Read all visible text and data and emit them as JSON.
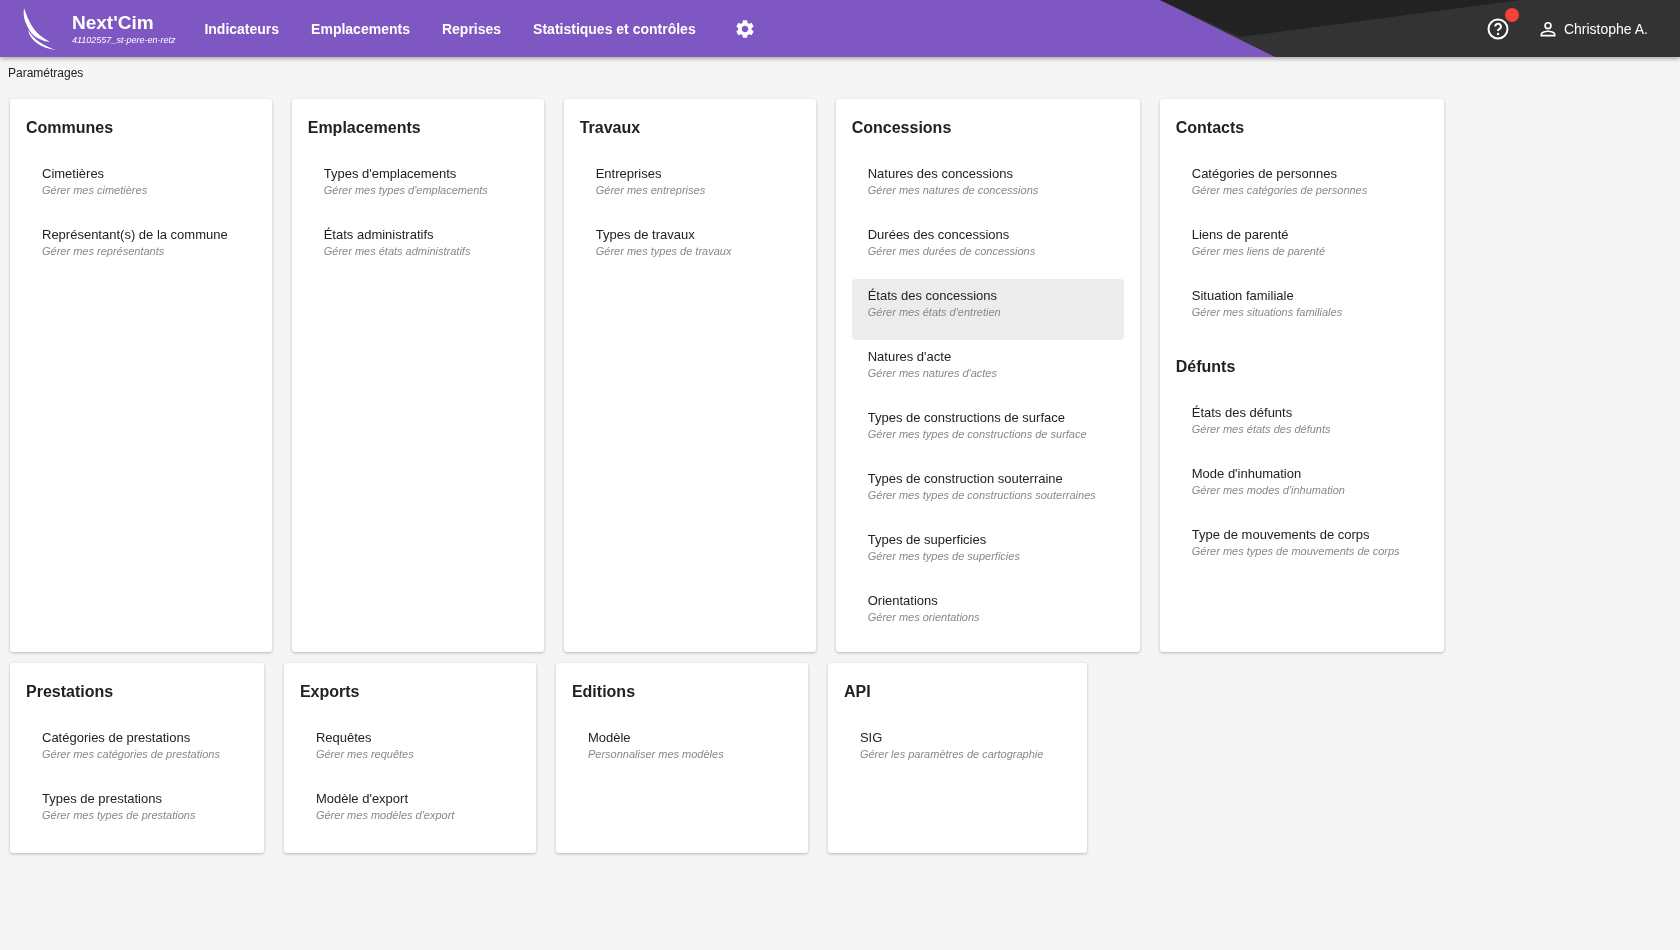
{
  "header": {
    "brand": "Next'Cim",
    "site": "41102557_st-pere-en-retz",
    "nav": [
      {
        "label": "Indicateurs"
      },
      {
        "label": "Emplacements"
      },
      {
        "label": "Reprises"
      },
      {
        "label": "Statistiques et contrôles"
      }
    ],
    "notification": true,
    "user": "Christophe A."
  },
  "breadcrumb": "Paramétrages",
  "rows": [
    [
      {
        "sections": [
          {
            "title": "Communes",
            "items": [
              {
                "label": "Cimetières",
                "description": "Gérer mes cimetières",
                "selected": false
              },
              {
                "label": "Représentant(s) de la commune",
                "description": "Gérer mes représentants",
                "selected": false
              }
            ]
          }
        ]
      },
      {
        "sections": [
          {
            "title": "Emplacements",
            "items": [
              {
                "label": "Types d'emplacements",
                "description": "Gérer mes types d'emplacements",
                "selected": false
              },
              {
                "label": "États administratifs",
                "description": "Gérer mes états administratifs",
                "selected": false
              }
            ]
          }
        ]
      },
      {
        "sections": [
          {
            "title": "Travaux",
            "items": [
              {
                "label": "Entreprises",
                "description": "Gérer mes entreprises",
                "selected": false
              },
              {
                "label": "Types de travaux",
                "description": "Gérer mes types de travaux",
                "selected": false
              }
            ]
          }
        ]
      },
      {
        "sections": [
          {
            "title": "Concessions",
            "items": [
              {
                "label": "Natures des concessions",
                "description": "Gérer mes natures de concessions",
                "selected": false
              },
              {
                "label": "Durées des concessions",
                "description": "Gérer mes durées de concessions",
                "selected": false
              },
              {
                "label": "États des concessions",
                "description": "Gérer mes états d'entretien",
                "selected": true
              },
              {
                "label": "Natures d'acte",
                "description": "Gérer mes natures d'actes",
                "selected": false
              },
              {
                "label": "Types de constructions de surface",
                "description": "Gérer mes types de constructions de surface",
                "selected": false
              },
              {
                "label": "Types de construction souterraine",
                "description": "Gérer mes types de constructions souterraines",
                "selected": false
              },
              {
                "label": "Types de superficies",
                "description": "Gérer mes types de superficies",
                "selected": false
              },
              {
                "label": "Orientations",
                "description": "Gérer mes orientations",
                "selected": false
              }
            ]
          }
        ]
      },
      {
        "sections": [
          {
            "title": "Contacts",
            "items": [
              {
                "label": "Catégories de personnes",
                "description": "Gérer mes catégories de personnes",
                "selected": false
              },
              {
                "label": "Liens de parenté",
                "description": "Gérer mes liens de parenté",
                "selected": false
              },
              {
                "label": "Situation familiale",
                "description": "Gérer mes situations familiales",
                "selected": false
              }
            ]
          },
          {
            "title": "Défunts",
            "items": [
              {
                "label": "États des défunts",
                "description": "Gérer mes états des défunts",
                "selected": false
              },
              {
                "label": "Mode d'inhumation",
                "description": "Gérer mes modes d'inhumation",
                "selected": false
              },
              {
                "label": "Type de mouvements de corps",
                "description": "Gérer mes types de mouvements de corps",
                "selected": false
              }
            ]
          }
        ]
      }
    ],
    [
      {
        "sections": [
          {
            "title": "Prestations",
            "items": [
              {
                "label": "Catégories de prestations",
                "description": "Gérer mes catégories de prestations",
                "selected": false
              },
              {
                "label": "Types de prestations",
                "description": "Gérer mes types de prestations",
                "selected": false
              }
            ]
          }
        ]
      },
      {
        "sections": [
          {
            "title": "Exports",
            "items": [
              {
                "label": "Requêtes",
                "description": "Gérer mes requêtes",
                "selected": false
              },
              {
                "label": "Modèle d'export",
                "description": "Gérer mes modèles d'export",
                "selected": false
              }
            ]
          }
        ]
      },
      {
        "sections": [
          {
            "title": "Editions",
            "items": [
              {
                "label": "Modèle",
                "description": "Personnaliser mes modèles",
                "selected": false
              }
            ]
          }
        ]
      },
      {
        "sections": [
          {
            "title": "API",
            "items": [
              {
                "label": "SIG",
                "description": "Gérer les paramètres de cartographie",
                "selected": false
              }
            ]
          }
        ]
      }
    ]
  ]
}
